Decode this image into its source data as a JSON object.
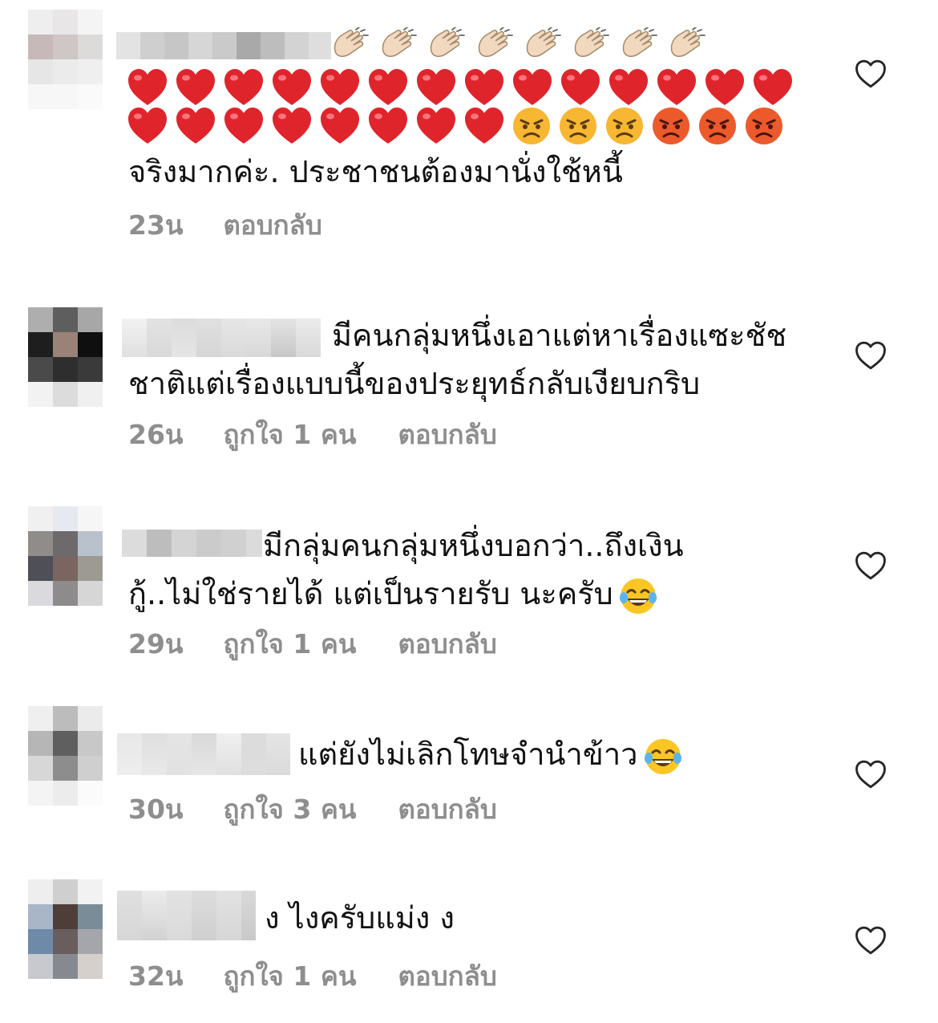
{
  "comments": [
    {
      "line1_emojis": [
        "clapping-hands-light",
        "clapping-hands-light",
        "clapping-hands-light",
        "clapping-hands-light",
        "clapping-hands-light",
        "clapping-hands-light",
        "clapping-hands-light",
        "clapping-hands-light"
      ],
      "line2_emojis": [
        "red-heart",
        "red-heart",
        "red-heart",
        "red-heart",
        "red-heart",
        "red-heart",
        "red-heart",
        "red-heart",
        "red-heart",
        "red-heart",
        "red-heart",
        "red-heart",
        "red-heart",
        "red-heart"
      ],
      "line3_emojis": [
        "red-heart",
        "red-heart",
        "red-heart",
        "red-heart",
        "red-heart",
        "red-heart",
        "red-heart",
        "red-heart",
        "angry-face",
        "angry-face",
        "angry-face",
        "pouting-face",
        "pouting-face",
        "pouting-face"
      ],
      "text_lines": [
        "จริงมากค่ะ. ประชาชนต้องมานั่งใช้หนี้"
      ],
      "time": "23น",
      "likes": "",
      "reply": "ตอบกลับ"
    },
    {
      "text_lines": [
        "มีคนกลุ่มหนึ่งเอาแต่หาเรื่องแซะชัช",
        "ชาติแต่เรื่องแบบนี้ของประยุทธ์กลับเงียบกริบ"
      ],
      "time": "26น",
      "likes": "ถูกใจ 1 คน",
      "reply": "ตอบกลับ"
    },
    {
      "text_lines": [
        "มีกลุ่มคนกลุ่มหนึ่งบอกว่า..ถึงเงิน",
        "กู้..ไม่ใช่รายได้ แต่เป็นรายรับ นะครับ"
      ],
      "trailing_emoji": "face-with-tears-of-joy",
      "time": "29น",
      "likes": "ถูกใจ 1 คน",
      "reply": "ตอบกลับ"
    },
    {
      "text_lines": [
        "แต่ยังไม่เลิกโทษจำนำข้าว"
      ],
      "trailing_emoji": "face-with-tears-of-joy",
      "time": "30น",
      "likes": "ถูกใจ 3 คน",
      "reply": "ตอบกลับ"
    },
    {
      "text_lines": [
        "ง ไงครับแม่ง ง"
      ],
      "time": "32น",
      "likes": "ถูกใจ 1 คน",
      "reply": "ตอบกลับ"
    }
  ],
  "colors": {
    "text": "#111111",
    "meta": "#8e8e8e",
    "heart_outline": "#262626",
    "emoji_red_heart": "#e0242c",
    "emoji_angry": "#f7b733",
    "emoji_pouting": "#ec5a2c"
  },
  "icons": {
    "like": "heart-outline-icon"
  }
}
